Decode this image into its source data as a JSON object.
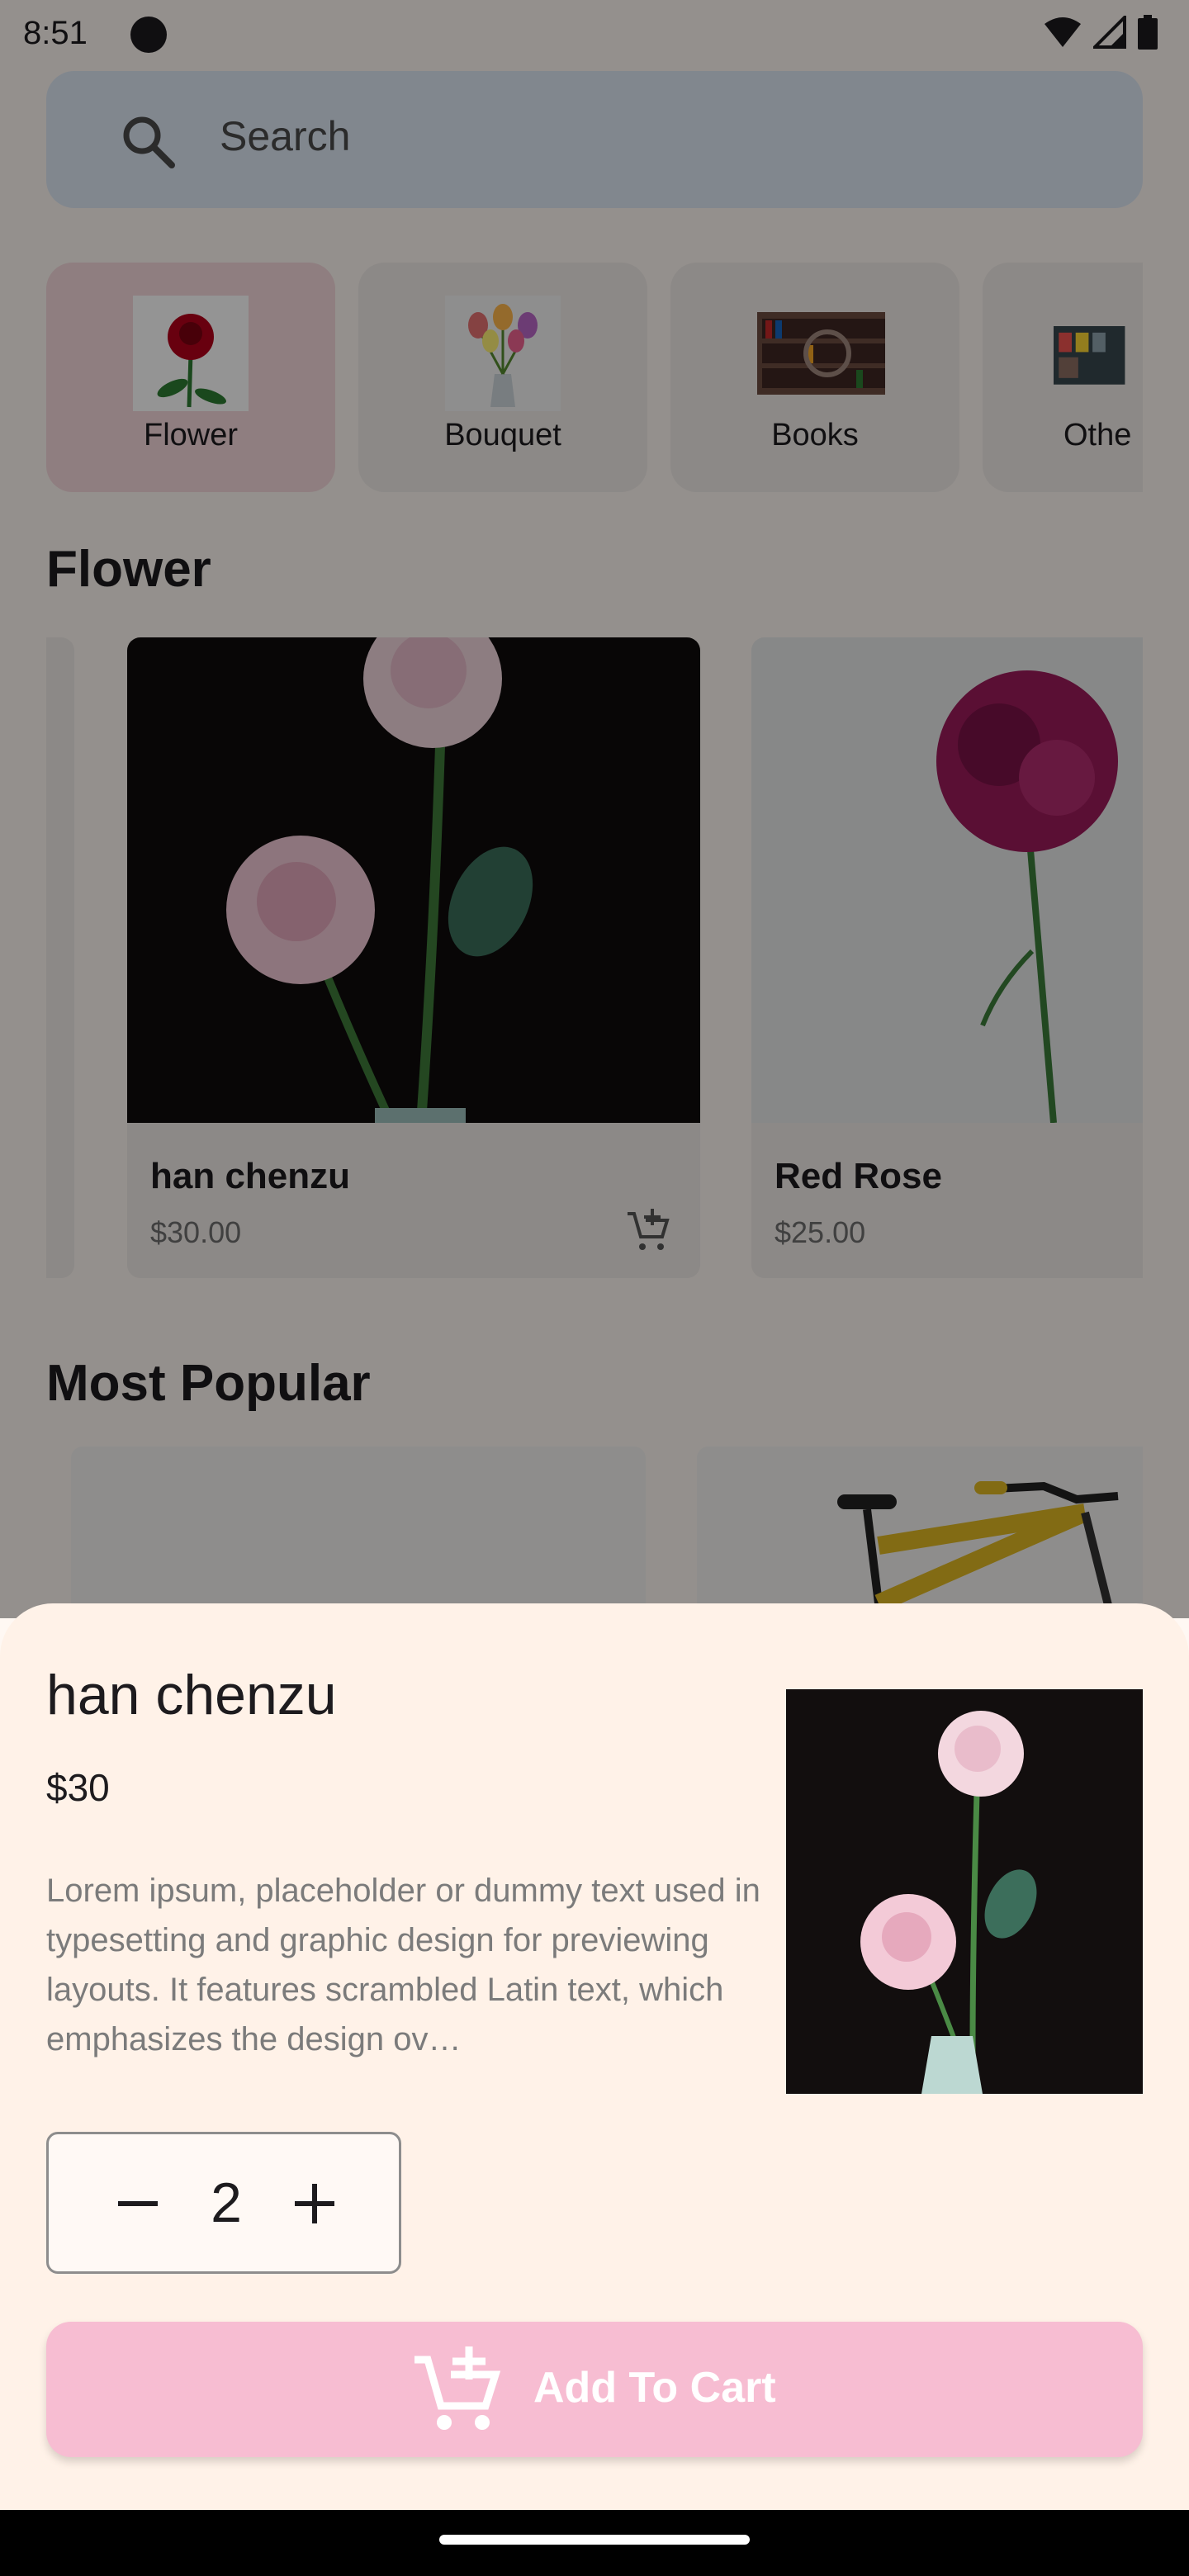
{
  "status_bar": {
    "time": "8:51",
    "icons": [
      "cat-icon",
      "wifi-icon",
      "signal-icon",
      "battery-icon"
    ]
  },
  "search": {
    "placeholder": "Search",
    "icon": "search-icon"
  },
  "categories": [
    {
      "label": "Flower",
      "selected": true
    },
    {
      "label": "Bouquet",
      "selected": false
    },
    {
      "label": "Books",
      "selected": false
    },
    {
      "label": "Othe",
      "selected": false
    }
  ],
  "sections": {
    "flower": "Flower",
    "popular": "Most Popular"
  },
  "flower_products": [
    {
      "name": "han chenzu",
      "price": "$30.00"
    },
    {
      "name": "Red Rose",
      "price": "$25.00"
    }
  ],
  "sheet": {
    "title": "han chenzu",
    "price": "$30",
    "description": "Lorem ipsum, placeholder or dummy text used in typesetting and graphic design for previewing layouts. It features scrambled Latin text, which emphasizes the design ov…",
    "quantity": "2",
    "add_to_cart_label": "Add To Cart"
  },
  "colors": {
    "accent_pink": "#f7bdd2",
    "selected_category": "#f6d9dc",
    "sheet_background": "#fff2e8",
    "search_background": "#dfe8f5"
  }
}
